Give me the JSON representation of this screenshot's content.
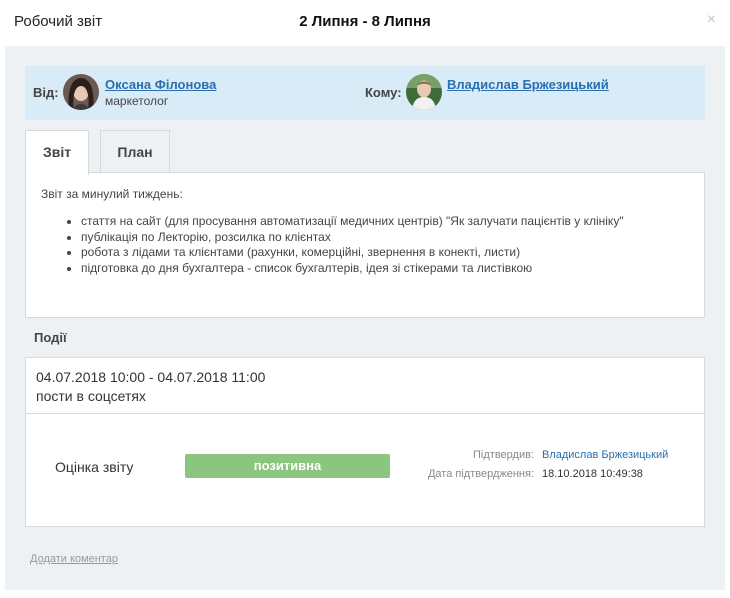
{
  "header": {
    "app_title": "Робочий звіт",
    "date_range": "2 Липня - 8 Липня",
    "close_symbol": "×"
  },
  "from": {
    "label": "Від:",
    "name": "Оксана Філонова",
    "role": "маркетолог"
  },
  "to": {
    "label": "Кому:",
    "name": "Владислав Бржезицький"
  },
  "tabs": [
    {
      "label": "Звіт",
      "active": true
    },
    {
      "label": "План",
      "active": false
    }
  ],
  "report": {
    "intro": "Звіт за минулий тиждень:",
    "items": [
      "стаття на сайт (для просування автоматизації медичних центрів) \"Як залучати пацієнтів у клініку\"",
      "публікація по Лекторію, розсилка по клієнтах",
      "робота з лідами та клієнтами (рахунки, комерційні, звернення в конекті, листи)",
      "підготовка до дня бухгалтера - список бухгалтерів, ідея зі стікерами та листівкою"
    ]
  },
  "events": {
    "title": "Події",
    "time": "04.07.2018 10:00 - 04.07.2018 11:00",
    "description": "пости в соцсетях"
  },
  "rating": {
    "label": "Оцінка звіту",
    "value": "позитивна",
    "confirmed_by_label": "Підтвердив:",
    "confirmed_by": "Владислав Бржезицький",
    "confirmed_date_label": "Дата підтвердження:",
    "confirmed_date": "18.10.2018 10:49:38"
  },
  "add_comment": "Додати коментар",
  "colors": {
    "link": "#2a6fb0",
    "header_bg": "#d9ebf6",
    "panel_bg": "#eef1f3",
    "positive": "#8cc57f"
  }
}
